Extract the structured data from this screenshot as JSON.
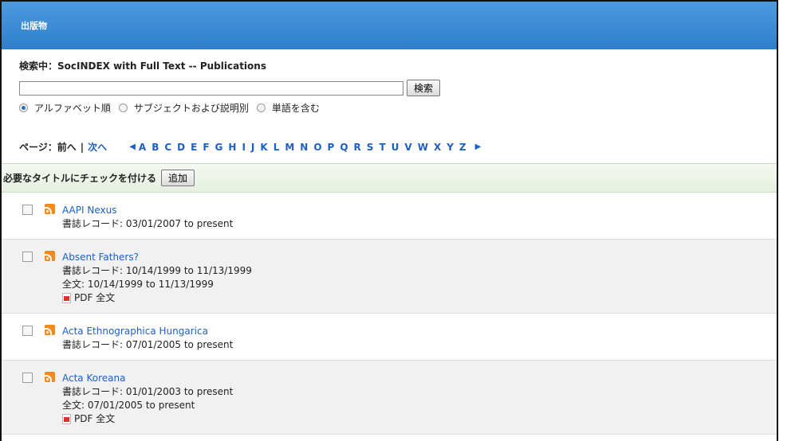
{
  "header": {
    "title": "出版物"
  },
  "search": {
    "searching_label": "検索中：SocINDEX with Full Text -- Publications",
    "input_value": "",
    "button_label": "検索",
    "options": [
      "アルファベット順",
      "サブジェクトおよび説明別",
      "単語を含む"
    ]
  },
  "pager": {
    "label": "ページ：",
    "prev": "前へ",
    "separator": "|",
    "next": "次へ",
    "letters": [
      "A",
      "B",
      "C",
      "D",
      "E",
      "F",
      "G",
      "H",
      "I",
      "J",
      "K",
      "L",
      "M",
      "N",
      "O",
      "P",
      "Q",
      "R",
      "S",
      "T",
      "U",
      "V",
      "W",
      "X",
      "Y",
      "Z"
    ]
  },
  "addbar": {
    "label": "必要なタイトルにチェックを付ける",
    "button_label": "追加"
  },
  "items": [
    {
      "title": "AAPI Nexus",
      "biblio": "書誌レコード: 03/01/2007 to present"
    },
    {
      "title": "Absent Fathers?",
      "biblio": "書誌レコード: 10/14/1999 to 11/13/1999",
      "fulltext": "全文: 10/14/1999 to 11/13/1999",
      "pdf": "PDF 全文"
    },
    {
      "title": "Acta Ethnographica Hungarica",
      "biblio": "書誌レコード: 07/01/2005 to present"
    },
    {
      "title": "Acta Koreana",
      "biblio": "書誌レコード: 01/01/2003 to present",
      "fulltext": "全文: 07/01/2005 to present",
      "pdf": "PDF 全文"
    }
  ]
}
